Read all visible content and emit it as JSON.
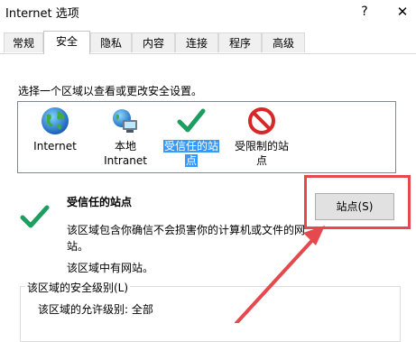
{
  "window": {
    "title": "Internet 选项",
    "help": "?",
    "close": "✕"
  },
  "tabs": [
    {
      "label": "常规"
    },
    {
      "label": "安全"
    },
    {
      "label": "隐私"
    },
    {
      "label": "内容"
    },
    {
      "label": "连接"
    },
    {
      "label": "程序"
    },
    {
      "label": "高级"
    }
  ],
  "security": {
    "prompt": "选择一个区域以查看或更改安全设置。",
    "zones": [
      {
        "label1": "Internet",
        "label2": "",
        "icon": "globe-icon"
      },
      {
        "label1": "本地",
        "label2": "Intranet",
        "icon": "local-intranet-icon"
      },
      {
        "label1": "受信任的站",
        "label2": "点",
        "icon": "checkmark-icon"
      },
      {
        "label1": "受限制的站",
        "label2": "点",
        "icon": "restricted-icon"
      }
    ],
    "selected_zone_title": "受信任的站点",
    "description": "该区域包含你确信不会损害你的计算机或文件的网站。",
    "no_sites": "该区域中有网站。",
    "sites_button": "站点(S)",
    "level_group": "该区域的安全级别(L)",
    "allowed_level": "该区域的允许级别: 全部"
  },
  "colors": {
    "selection": "#3399ff",
    "highlight": "#e5484d",
    "check": "#1d9e60"
  }
}
